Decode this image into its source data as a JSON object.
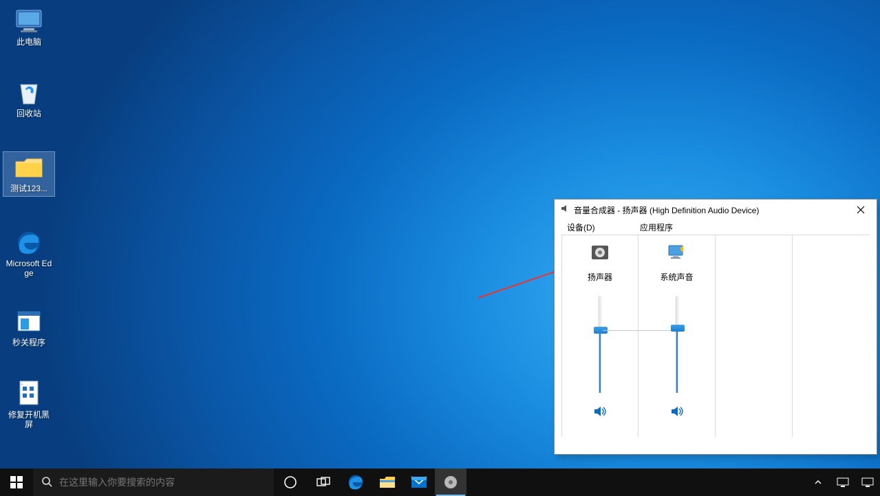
{
  "desktop": {
    "icons": [
      {
        "label": "此电脑",
        "kind": "pc"
      },
      {
        "label": "回收站",
        "kind": "bin"
      },
      {
        "label": "测试123...",
        "kind": "folder",
        "selected": true
      },
      {
        "label": "Microsoft Edge",
        "kind": "edge"
      },
      {
        "label": "秒关程序",
        "kind": "prog"
      },
      {
        "label": "修复开机黑屏",
        "kind": "repair"
      }
    ]
  },
  "taskbar": {
    "search_placeholder": "在这里输入你要搜索的内容"
  },
  "mixer": {
    "title": "音量合成器 - 扬声器 (High Definition Audio Device)",
    "device_header": "设备(D)",
    "app_header": "应用程序",
    "columns": [
      {
        "label": "扬声器",
        "level_pct": 65,
        "kind": "speaker"
      },
      {
        "label": "系统声音",
        "level_pct": 67,
        "kind": "syssound"
      }
    ]
  }
}
